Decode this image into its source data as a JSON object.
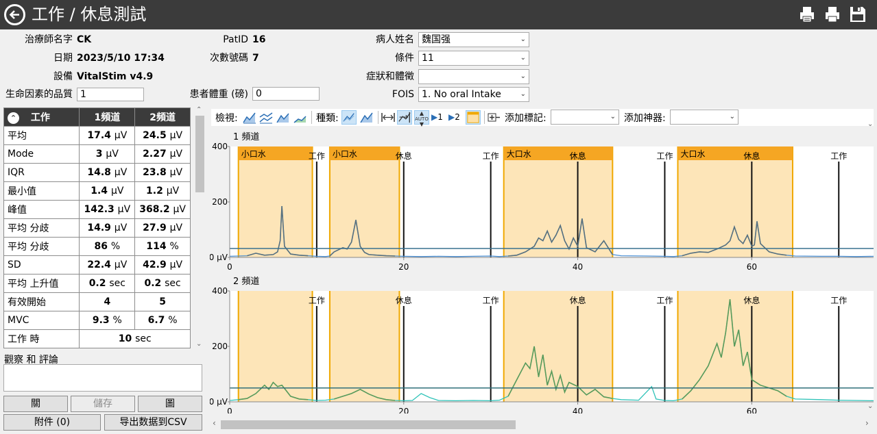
{
  "app": {
    "title": "工作 / 休息測試"
  },
  "info": {
    "therapist_label": "治療師名字",
    "therapist_value": "CK",
    "date_label": "日期",
    "date_value": "2023/5/10 17:34",
    "device_label": "設備",
    "device_value": "VitalStim v4.9",
    "qol_label": "生命因素的品質",
    "qol_value": "1",
    "patid_label": "PatID",
    "patid_value": "16",
    "session_label": "次數號碼",
    "session_value": "7",
    "weight_label": "患者體重 (磅)",
    "weight_value": "0",
    "patient_label": "病人姓名",
    "patient_value": "魏国强",
    "condition_label": "條件",
    "condition_value": "11",
    "symptom_label": "症狀和體徵",
    "symptom_value": "",
    "fois_label": "FOIS",
    "fois_value": "1. No oral Intake"
  },
  "stats": {
    "headers": [
      "工作",
      "1頻道",
      "2頻道"
    ],
    "rows": [
      {
        "label": "平均",
        "c1": "17.4",
        "c1u": "μV",
        "c2": "24.5",
        "c2u": "μV"
      },
      {
        "label": "Mode",
        "c1": "3",
        "c1u": "μV",
        "c2": "2.27",
        "c2u": "μV"
      },
      {
        "label": "IQR",
        "c1": "14.8",
        "c1u": "μV",
        "c2": "23.8",
        "c2u": "μV"
      },
      {
        "label": "最小值",
        "c1": "1.4",
        "c1u": "μV",
        "c2": "1.2",
        "c2u": "μV"
      },
      {
        "label": "峰值",
        "c1": "142.3",
        "c1u": "μV",
        "c2": "368.2",
        "c2u": "μV"
      },
      {
        "label": "平均 分歧",
        "c1": "14.9",
        "c1u": "μV",
        "c2": "27.9",
        "c2u": "μV"
      },
      {
        "label": "平均 分歧",
        "c1": "86",
        "c1u": "%",
        "c2": "114",
        "c2u": "%"
      },
      {
        "label": "SD",
        "c1": "22.4",
        "c1u": "μV",
        "c2": "42.9",
        "c2u": "μV"
      },
      {
        "label": "平均 上升值",
        "c1": "0.2",
        "c1u": "sec",
        "c2": "0.2",
        "c2u": "sec"
      },
      {
        "label": "有效開始",
        "c1": "4",
        "c1u": "",
        "c2": "5",
        "c2u": ""
      },
      {
        "label": "MVC",
        "c1": "9.3",
        "c1u": "%",
        "c2": "6.7",
        "c2u": "%"
      }
    ],
    "work_time_label": "工作 時",
    "work_time_value": "10",
    "work_time_unit": "sec"
  },
  "notes": {
    "label": "觀察 和 評論",
    "value": ""
  },
  "buttons": {
    "close": "關",
    "save": "儲存",
    "chart": "圖",
    "attach": "附件 (0)",
    "export": "导出数据到CSV"
  },
  "toolbar": {
    "view_label": "檢視:",
    "type_label": "種類:",
    "add_marker_label": "添加標記:",
    "add_device_label": "添加神器:",
    "auto_label": "AUTO",
    "ch1_btn": "1",
    "ch2_btn": "2"
  },
  "charts": {
    "channel1_title": "1 頻道",
    "channel2_title": "2 頻道",
    "y_ticks": [
      "400",
      "200",
      "0 μV"
    ],
    "x_ticks": [
      "0",
      "20",
      "40",
      "60"
    ],
    "events": [
      {
        "label": "小口水",
        "start": 1,
        "end": 9.5
      },
      {
        "label": "小口水",
        "start": 11.5,
        "end": 19.5
      },
      {
        "label": "大口水",
        "start": 31.5,
        "end": 44
      },
      {
        "label": "大口水",
        "start": 51.5,
        "end": 64.7
      }
    ],
    "markers": [
      {
        "label": "工作",
        "t": 10
      },
      {
        "label": "休息",
        "t": 20
      },
      {
        "label": "工作",
        "t": 30
      },
      {
        "label": "休息",
        "t": 40
      },
      {
        "label": "工作",
        "t": 50
      },
      {
        "label": "休息",
        "t": 60
      },
      {
        "label": "工作",
        "t": 70
      }
    ]
  },
  "chart_data": [
    {
      "type": "line",
      "title": "1 頻道",
      "xlim": [
        0,
        74
      ],
      "ylim": [
        0,
        400
      ],
      "x_ticks": [
        0,
        20,
        40,
        60
      ],
      "y_ticks": [
        0,
        200,
        400
      ],
      "threshold": 32,
      "series": [
        {
          "x": [
            0,
            2,
            3,
            4,
            5,
            5.5,
            5.8,
            6,
            6.3,
            7,
            8,
            9,
            10,
            11,
            11.5,
            12,
            13,
            13.5,
            14,
            14.5,
            15,
            15.5,
            16,
            17,
            18,
            19,
            20,
            22,
            24,
            26,
            28,
            30,
            31,
            32,
            33,
            34,
            35,
            35.5,
            36,
            36.5,
            37,
            37.5,
            38,
            38.5,
            39,
            39.5,
            40,
            40.5,
            41,
            42,
            43,
            44,
            45,
            48,
            50,
            51,
            52,
            53,
            54,
            55,
            56,
            57,
            57.5,
            58,
            58.5,
            59,
            59.5,
            60,
            60.3,
            60.6,
            61,
            62,
            63,
            64,
            65,
            68,
            70,
            72,
            74
          ],
          "y": [
            4,
            6,
            15,
            8,
            10,
            20,
            60,
            185,
            40,
            12,
            8,
            6,
            4,
            3,
            5,
            20,
            35,
            30,
            55,
            135,
            40,
            18,
            10,
            8,
            6,
            5,
            4,
            3,
            4,
            3,
            4,
            5,
            3,
            5,
            8,
            20,
            40,
            70,
            60,
            95,
            55,
            80,
            115,
            60,
            30,
            70,
            40,
            140,
            35,
            20,
            60,
            10,
            6,
            5,
            4,
            3,
            6,
            15,
            20,
            18,
            30,
            45,
            60,
            110,
            65,
            50,
            80,
            40,
            45,
            130,
            50,
            20,
            12,
            8,
            5,
            4,
            4,
            3,
            4
          ]
        }
      ]
    },
    {
      "type": "line",
      "title": "2 頻道",
      "xlim": [
        0,
        74
      ],
      "ylim": [
        0,
        400
      ],
      "x_ticks": [
        0,
        20,
        40,
        60
      ],
      "y_ticks": [
        0,
        200,
        400
      ],
      "threshold": 50,
      "series": [
        {
          "x": [
            0,
            1,
            2,
            3,
            4,
            4.5,
            5,
            5.5,
            6,
            6.5,
            7,
            8,
            9,
            10,
            11,
            12,
            13,
            14,
            15,
            16,
            17,
            18,
            19,
            20,
            21,
            22,
            23,
            24,
            26,
            28,
            30,
            31,
            32,
            33,
            34,
            34.5,
            35,
            35.5,
            36,
            36.5,
            37,
            37.5,
            38,
            38.5,
            39,
            40,
            41,
            42,
            43,
            44,
            45,
            47,
            48.5,
            49,
            50,
            51,
            52,
            53,
            54,
            55,
            55.5,
            56,
            56.5,
            57,
            57.5,
            58,
            58.5,
            59,
            59.5,
            60,
            61,
            62,
            63,
            64,
            65,
            68,
            70,
            72,
            74
          ],
          "y": [
            5,
            8,
            12,
            30,
            60,
            45,
            70,
            55,
            60,
            40,
            20,
            10,
            8,
            5,
            6,
            10,
            20,
            30,
            45,
            28,
            15,
            8,
            5,
            4,
            5,
            30,
            15,
            5,
            4,
            5,
            4,
            6,
            20,
            80,
            140,
            120,
            200,
            90,
            170,
            60,
            110,
            45,
            95,
            35,
            70,
            55,
            25,
            45,
            18,
            12,
            8,
            6,
            55,
            10,
            5,
            4,
            10,
            40,
            80,
            130,
            170,
            210,
            160,
            250,
            370,
            200,
            260,
            130,
            180,
            80,
            60,
            50,
            40,
            20,
            10,
            8,
            6,
            5,
            4
          ]
        }
      ]
    }
  ]
}
